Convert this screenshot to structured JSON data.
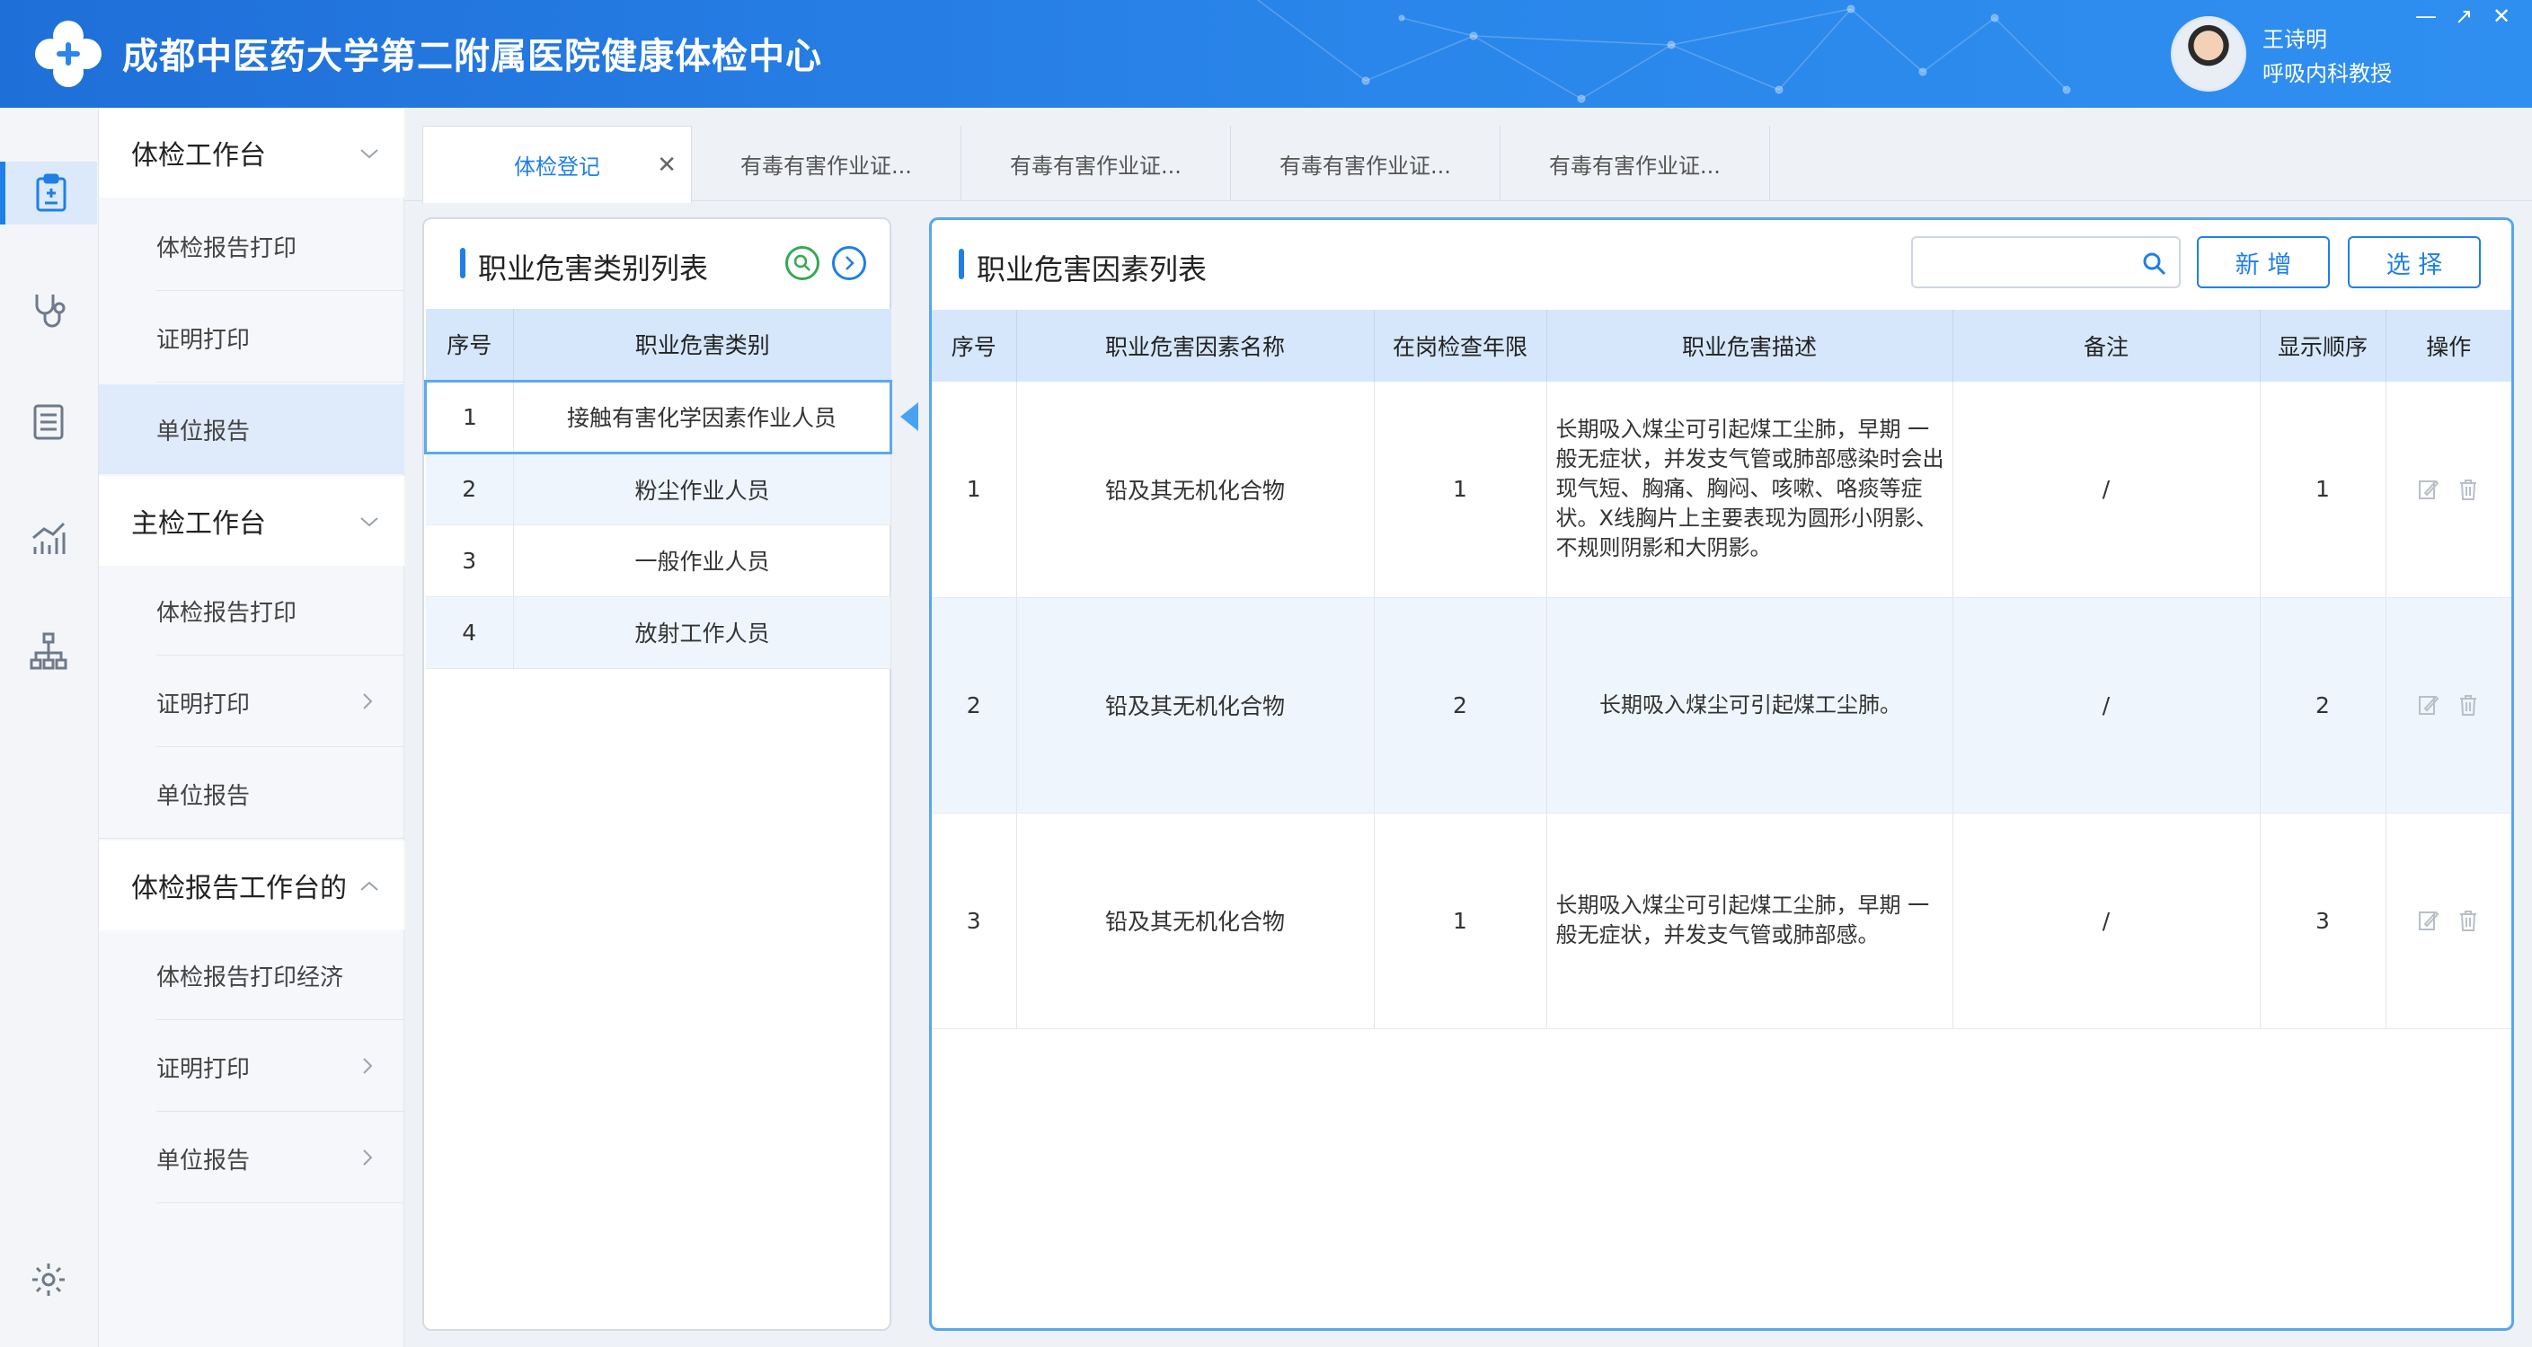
{
  "header": {
    "title": "成都中医药大学第二附属医院健康体检中心",
    "user_name": "王诗明",
    "user_role": "呼吸内科教授",
    "window_controls": [
      "—",
      "↗",
      "✕"
    ]
  },
  "rail": {
    "icons": [
      "clipboard-icon",
      "stethoscope-icon",
      "document-list-icon",
      "chart-icon",
      "org-tree-icon",
      "settings-icon"
    ]
  },
  "sidebar": {
    "groups": [
      {
        "label": "体检工作台",
        "items": [
          "体检报告打印",
          "证明打印",
          "单位报告"
        ]
      },
      {
        "label": "主检工作台",
        "items": [
          "体检报告打印",
          "证明打印",
          "单位报告"
        ]
      },
      {
        "label": "体检报告工作台的",
        "items": [
          "体检报告打印经济",
          "证明打印",
          "单位报告"
        ]
      }
    ]
  },
  "tabs": [
    {
      "label": "体检登记",
      "active": true
    },
    {
      "label": "有毒有害作业证..."
    },
    {
      "label": "有毒有害作业证..."
    },
    {
      "label": "有毒有害作业证..."
    },
    {
      "label": "有毒有害作业证..."
    }
  ],
  "category_panel": {
    "title": "职业危害类别列表",
    "columns": [
      "序号",
      "职业危害类别"
    ],
    "rows": [
      {
        "no": "1",
        "name": "接触有害化学因素作业人员"
      },
      {
        "no": "2",
        "name": "粉尘作业人员"
      },
      {
        "no": "3",
        "name": "一般作业人员"
      },
      {
        "no": "4",
        "name": "放射工作人员"
      }
    ]
  },
  "factor_panel": {
    "title": "职业危害因素列表",
    "search_placeholder": "",
    "add_label": "新 增",
    "select_label": "选 择",
    "columns": [
      "序号",
      "职业危害因素名称",
      "在岗检查年限",
      "职业危害描述",
      "备注",
      "显示顺序",
      "操作"
    ],
    "rows": [
      {
        "no": "1",
        "name": "铅及其无机化合物",
        "years": "1",
        "desc": "长期吸入煤尘可引起煤工尘肺，早期 一般无症状，并发支气管或肺部感染时会出现气短、胸痛、胸闷、咳嗽、咯痰等症状。X线胸片上主要表现为圆形小阴影、不规则阴影和大阴影。",
        "note": "/",
        "order": "1"
      },
      {
        "no": "2",
        "name": "铅及其无机化合物",
        "years": "2",
        "desc": "长期吸入煤尘可引起煤工尘肺。",
        "note": "/",
        "order": "2"
      },
      {
        "no": "3",
        "name": "铅及其无机化合物",
        "years": "1",
        "desc": "长期吸入煤尘可引起煤工尘肺，早期 一般无症状，并发支气管或肺部感。",
        "note": "/",
        "order": "3"
      }
    ]
  }
}
